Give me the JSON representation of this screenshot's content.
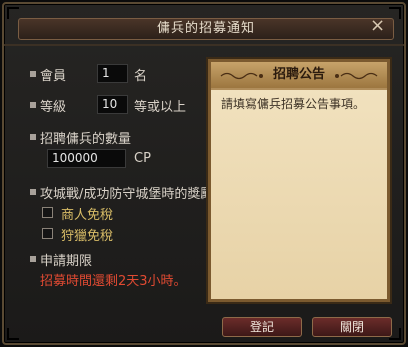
{
  "window": {
    "title": "傭兵的招募通知"
  },
  "form": {
    "members": {
      "label": "會員",
      "value": "1",
      "unit": "名"
    },
    "level": {
      "label": "等級",
      "value": "10",
      "unit": "等或以上"
    },
    "recruit_count": {
      "label": "招聘傭兵的數量",
      "value": "100000",
      "unit": "CP"
    },
    "reward": {
      "label": "攻城戰/成功防守城堡時的獎勵",
      "options": [
        {
          "label": "商人免稅",
          "checked": false
        },
        {
          "label": "狩獵免稅",
          "checked": false
        }
      ]
    },
    "period": {
      "label": "申請期限",
      "remaining_text": "招募時間還剩2天3小時。"
    }
  },
  "notice": {
    "title": "招聘公告",
    "placeholder": "請填寫傭兵招募公告事項。"
  },
  "buttons": {
    "register": "登記",
    "close": "關閉"
  },
  "icons": {
    "close": "close-icon",
    "bullet": "bullet-square-icon"
  }
}
